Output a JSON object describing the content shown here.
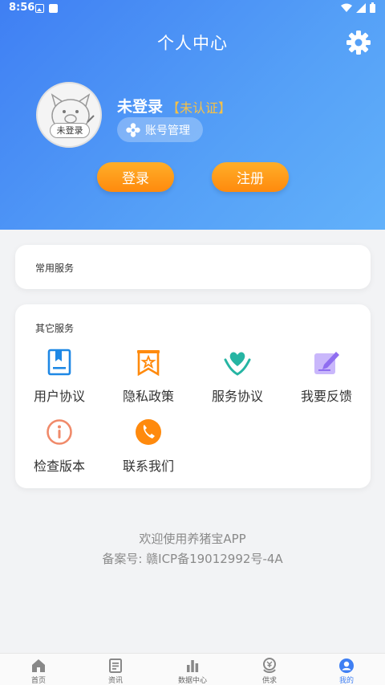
{
  "status_bar": {
    "time": "8:56"
  },
  "header": {
    "title": "个人中心",
    "settings_icon": "gear-icon"
  },
  "user": {
    "avatar_badge": "未登录",
    "name": "未登录",
    "tag": "【未认证】",
    "account_button": "账号管理"
  },
  "auth_buttons": {
    "login": "登录",
    "register": "注册"
  },
  "common_services": {
    "title": "常用服务"
  },
  "other_services": {
    "title": "其它服务",
    "items": [
      {
        "label": "用户协议",
        "icon": "document-icon",
        "color": "#1e88e5"
      },
      {
        "label": "隐私政策",
        "icon": "star-bookmark-icon",
        "color": "#ff8a0d"
      },
      {
        "label": "服务协议",
        "icon": "heart-hands-icon",
        "color": "#26b5a3"
      },
      {
        "label": "我要反馈",
        "icon": "edit-icon",
        "color": "#9b7af2"
      },
      {
        "label": "检查版本",
        "icon": "info-icon",
        "color": "#f08a6a"
      },
      {
        "label": "联系我们",
        "icon": "phone-icon",
        "color": "#ff8a0d"
      }
    ]
  },
  "footer": {
    "welcome": "欢迎使用养猪宝APP",
    "record": "备案号: 赣ICP备19012992号-4A"
  },
  "tabbar": {
    "tabs": [
      {
        "label": "首页",
        "icon": "home-icon"
      },
      {
        "label": "资讯",
        "icon": "news-icon"
      },
      {
        "label": "数据中心",
        "icon": "chart-icon"
      },
      {
        "label": "供求",
        "icon": "trade-icon"
      },
      {
        "label": "我的",
        "icon": "profile-icon",
        "active": true
      }
    ],
    "accent_color": "#3f7ff3"
  }
}
